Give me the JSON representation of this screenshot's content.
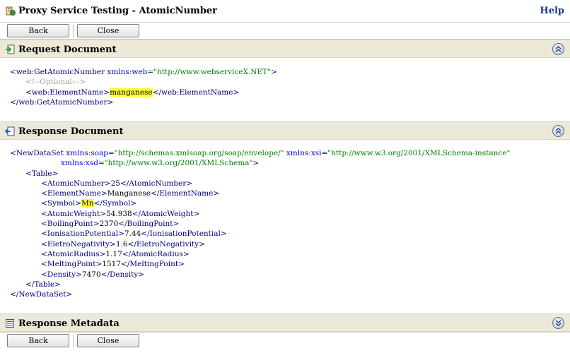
{
  "window": {
    "title": "Proxy Service Testing - AtomicNumber",
    "help_label": "Help"
  },
  "buttons": {
    "back_label": "Back",
    "close_label": "Close"
  },
  "request": {
    "title": "Request Document",
    "open_tag": "web:GetAtomicNumber",
    "ns_attr": "xmlns:web",
    "ns_val": "\"http://www.webserviceX.NET\"",
    "comment": "<!--Optional:-->",
    "element_tag": "web:ElementName",
    "element_value": "manganese",
    "close_tag": "web:GetAtomicNumber"
  },
  "response": {
    "title": "Response Document",
    "root_tag": "NewDataSet",
    "soap_attr": "xmlns:soap",
    "soap_val": "\"http://schemas.xmlsoap.org/soap/envelope/\"",
    "xsi_attr": "xmlns:xsi",
    "xsi_val": "\"http://www.w3.org/2001/XMLSchema-instance\"",
    "xsd_attr": "xmlns:xsd",
    "xsd_val": "\"http://www.w3.org/2001/XMLSchema\"",
    "table_tag": "Table",
    "fields": [
      {
        "tag": "AtomicNumber",
        "value": "25"
      },
      {
        "tag": "ElementName",
        "value": "Manganese"
      },
      {
        "tag": "Symbol",
        "value": "Mn"
      },
      {
        "tag": "AtomicWeight",
        "value": "54.938"
      },
      {
        "tag": "BoilingPoint",
        "value": "2370"
      },
      {
        "tag": "IonisationPotential",
        "value": "7.44"
      },
      {
        "tag": "EletroNegativity",
        "value": "1.6"
      },
      {
        "tag": "AtomicRadius",
        "value": "1.17"
      },
      {
        "tag": "MeltingPoint",
        "value": "1517"
      },
      {
        "tag": "Density",
        "value": "7470"
      }
    ]
  },
  "metadata": {
    "title": "Response Metadata"
  },
  "icons": {
    "app": "proxy-service-icon",
    "request": "request-document-icon",
    "response": "response-document-icon",
    "metadata": "metadata-icon",
    "collapse": "double-chevron-up-icon",
    "expand": "double-chevron-down-icon"
  },
  "colors": {
    "tag": "#00007f",
    "attribute": "#0000ff",
    "attribute_value": "#008000",
    "comment": "#a0a0a0",
    "highlight": "#ffff33",
    "header_bg": "#ece9d8",
    "help_link": "#1a3a8a"
  }
}
